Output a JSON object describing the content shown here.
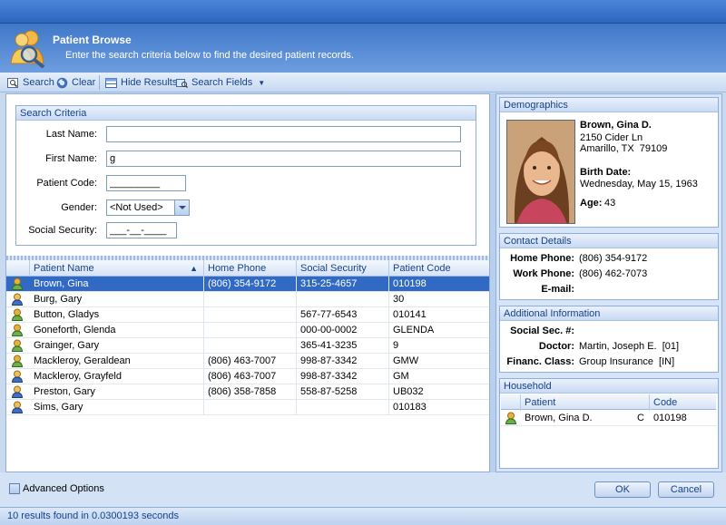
{
  "header": {
    "title": "Patient Browse",
    "subtitle": "Enter the search criteria below to find the desired patient records."
  },
  "toolbar": {
    "search": "Search",
    "clear": "Clear",
    "hide_results": "Hide Results",
    "search_fields": "Search Fields"
  },
  "criteria": {
    "title": "Search Criteria",
    "last_name_label": "Last Name:",
    "last_name_value": "",
    "first_name_label": "First Name:",
    "first_name_value": "g",
    "patient_code_label": "Patient Code:",
    "patient_code_value": "_________",
    "gender_label": "Gender:",
    "gender_value": "<Not Used>",
    "ssn_label": "Social Security:",
    "ssn_value": "___-__-____"
  },
  "grid": {
    "columns": [
      "Patient Name",
      "Home Phone",
      "Social Security",
      "Patient Code"
    ],
    "rows": [
      {
        "name": "Brown, Gina",
        "phone": "(806) 354-9172",
        "ssn": "315-25-4657",
        "code": "010198",
        "gender": "female"
      },
      {
        "name": "Burg, Gary",
        "phone": "",
        "ssn": "",
        "code": "30",
        "gender": "male"
      },
      {
        "name": "Button, Gladys",
        "phone": "",
        "ssn": "567-77-6543",
        "code": "010141",
        "gender": "female"
      },
      {
        "name": "Goneforth, Glenda",
        "phone": "",
        "ssn": "000-00-0002",
        "code": "GLENDA",
        "gender": "female"
      },
      {
        "name": "Grainger, Gary",
        "phone": "",
        "ssn": "365-41-3235",
        "code": "9",
        "gender": "female"
      },
      {
        "name": "Mackleroy, Geraldean",
        "phone": "(806) 463-7007",
        "ssn": "998-87-3342",
        "code": "GMW",
        "gender": "female"
      },
      {
        "name": "Mackleroy, Grayfeld",
        "phone": "(806) 463-7007",
        "ssn": "998-87-3342",
        "code": "GM",
        "gender": "male"
      },
      {
        "name": "Preston, Gary",
        "phone": "(806) 358-7858",
        "ssn": "558-87-5258",
        "code": "UB032",
        "gender": "male"
      },
      {
        "name": "Sims, Gary",
        "phone": "",
        "ssn": "",
        "code": "010183",
        "gender": "male"
      }
    ]
  },
  "demographics": {
    "title": "Demographics",
    "name": "Brown, Gina D.",
    "address1": "2150 Cider Ln",
    "address2": "Amarillo, TX  79109",
    "birth_label": "Birth Date:",
    "birth_value": "Wednesday, May 15, 1963",
    "age_label": "Age:",
    "age_value": "43"
  },
  "contact": {
    "title": "Contact Details",
    "home_label": "Home Phone:",
    "home_value": "(806) 354-9172",
    "work_label": "Work Phone:",
    "work_value": "(806) 462-7073",
    "email_label": "E-mail:",
    "email_value": ""
  },
  "additional": {
    "title": "Additional Information",
    "ssn_label": "Social Sec. #:",
    "ssn_value": "",
    "doctor_label": "Doctor:",
    "doctor_value": "Martin, Joseph E.  [01]",
    "fin_label": "Financ. Class:",
    "fin_value": "Group Insurance  [IN]"
  },
  "household": {
    "title": "Household",
    "col_patient": "Patient",
    "col_code": "Code",
    "rows": [
      {
        "name": "Brown, Gina D.",
        "rel": "C",
        "code": "010198"
      }
    ]
  },
  "footer": {
    "advanced": "Advanced Options",
    "ok": "OK",
    "cancel": "Cancel"
  },
  "status": "10 results found in 0.0300193 seconds",
  "colors": {
    "accent": "#316ac5",
    "header_text": "#15428b"
  }
}
